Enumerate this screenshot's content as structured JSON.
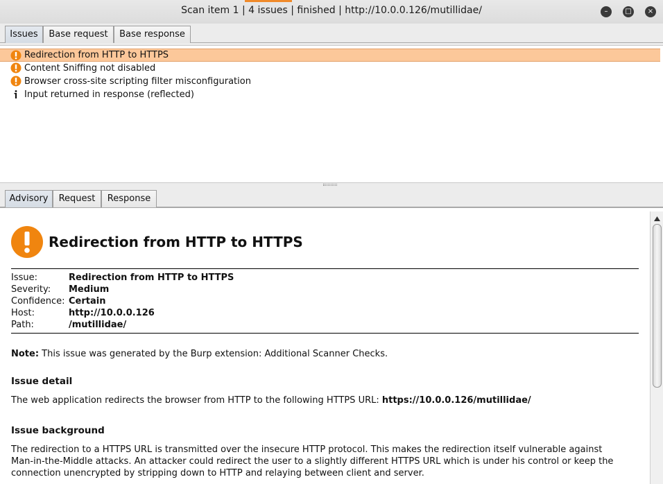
{
  "window": {
    "title": "Scan item 1 | 4 issues | finished | http://10.0.0.126/mutillidae/",
    "controls": [
      "minimize-icon",
      "maximize-icon",
      "close-icon"
    ]
  },
  "top_tabs": [
    "Issues",
    "Base request",
    "Base response"
  ],
  "issues": [
    {
      "icon": "warning-icon",
      "label": "Redirection from HTTP to HTTPS",
      "selected": true
    },
    {
      "icon": "warning-icon",
      "label": "Content Sniffing not disabled"
    },
    {
      "icon": "warning-icon",
      "label": "Browser cross-site scripting filter misconfiguration"
    },
    {
      "icon": "info-icon",
      "label": "Input returned in response (reflected)"
    }
  ],
  "detail_tabs": [
    "Advisory",
    "Request",
    "Response"
  ],
  "advisory": {
    "title": "Redirection from HTTP to HTTPS",
    "meta": [
      {
        "key": "Issue:",
        "value": "Redirection from HTTP to HTTPS"
      },
      {
        "key": "Severity:",
        "value": "Medium"
      },
      {
        "key": "Confidence:",
        "value": "Certain"
      },
      {
        "key": "Host:",
        "value": "http://10.0.0.126"
      },
      {
        "key": "Path:",
        "value": "/mutillidae/"
      }
    ],
    "note_label": "Note:",
    "note_text": " This issue was generated by the Burp extension: Additional Scanner Checks.",
    "detail_heading": "Issue detail",
    "detail_text": "The web application redirects the browser from HTTP to the following HTTPS URL: ",
    "detail_url": "https://10.0.0.126/mutillidae/",
    "background_heading": "Issue background",
    "background_text": "The redirection to a HTTPS URL is transmitted over the insecure HTTP protocol. This makes the redirection itself vulnerable against Man-in-the-Middle attacks. An attacker could redirect the user to a slightly different HTTPS URL which is under his control or keep the connection unencrypted by stripping down to HTTP and relaying between client and server."
  },
  "colors": {
    "warning": "#f0850f",
    "selected_row": "#fcc89a",
    "tab_active": "#d5dce4"
  }
}
